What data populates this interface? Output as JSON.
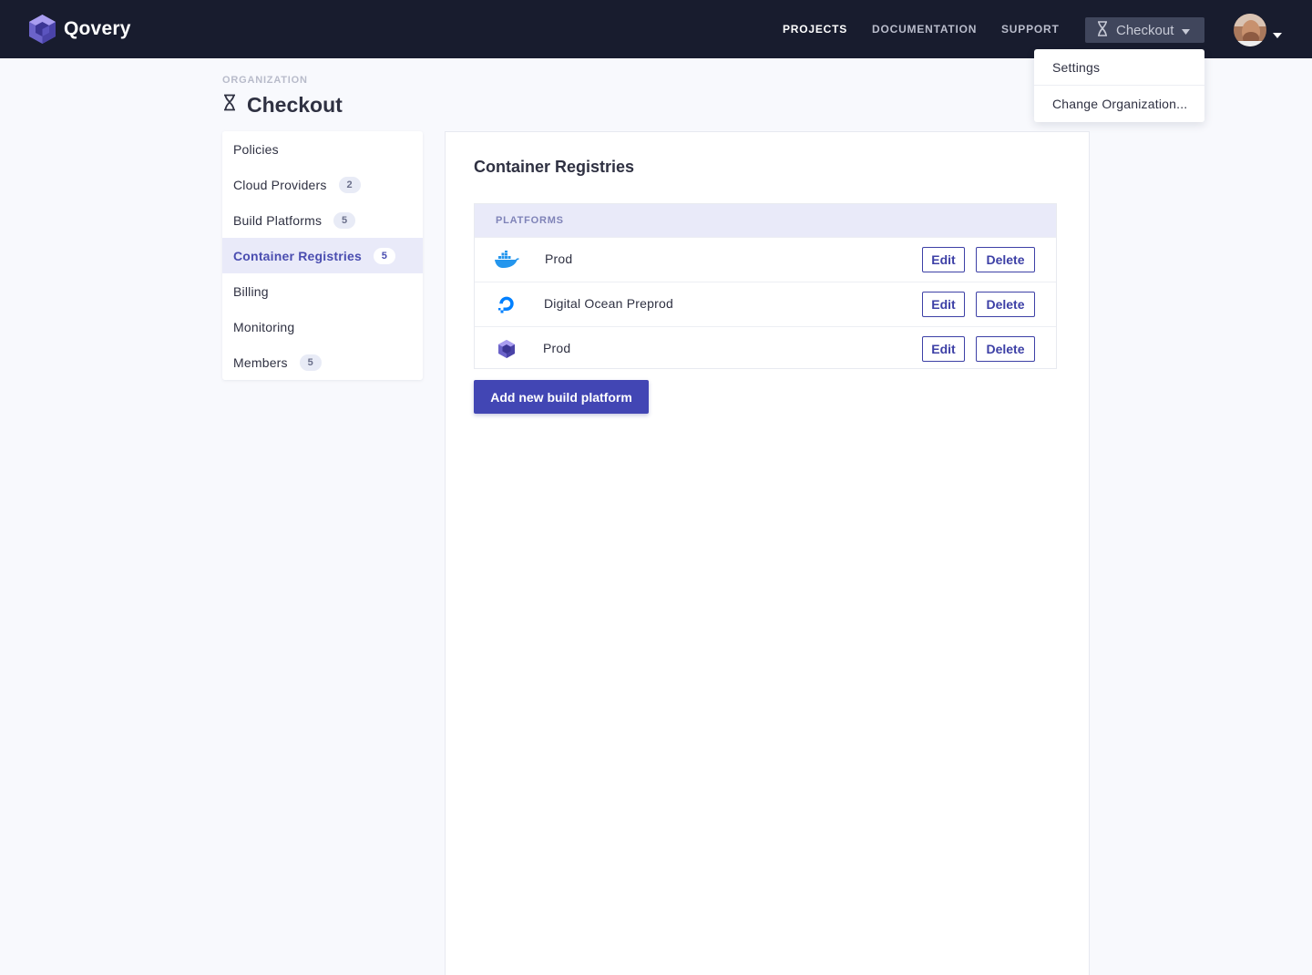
{
  "navbar": {
    "brand": "Qovery",
    "links": [
      "PROJECTS",
      "DOCUMENTATION",
      "SUPPORT"
    ],
    "org_switcher": {
      "label": "Checkout",
      "icon": "hourglass-icon"
    },
    "avatar": "user-avatar"
  },
  "dropdown": {
    "items": [
      "Settings",
      "Change Organization..."
    ]
  },
  "header": {
    "caption": "ORGANIZATION",
    "title": "Checkout"
  },
  "sidebar": {
    "items": [
      {
        "label": "Policies",
        "badge": ""
      },
      {
        "label": "Cloud Providers",
        "badge": "2"
      },
      {
        "label": "Build Platforms",
        "badge": "5"
      },
      {
        "label": "Container Registries",
        "badge": "5",
        "active": true
      },
      {
        "label": "Billing",
        "badge": ""
      },
      {
        "label": "Monitoring",
        "badge": ""
      },
      {
        "label": "Members",
        "badge": "5"
      }
    ]
  },
  "main": {
    "title": "Container Registries",
    "table": {
      "header": "PLATFORMS",
      "rows": [
        {
          "icon": "docker-icon",
          "name": "Prod",
          "edit": "Edit",
          "delete": "Delete"
        },
        {
          "icon": "digitalocean-icon",
          "name": "Digital Ocean Preprod",
          "edit": "Edit",
          "delete": "Delete"
        },
        {
          "icon": "qovery-icon",
          "name": "Prod",
          "edit": "Edit",
          "delete": "Delete"
        }
      ]
    },
    "add_button": "Add new build platform"
  },
  "colors": {
    "navbar": "#181c2e",
    "accent": "#4246b4",
    "active_bg": "#e9eaf9",
    "page_bg": "#f8f9fd"
  }
}
